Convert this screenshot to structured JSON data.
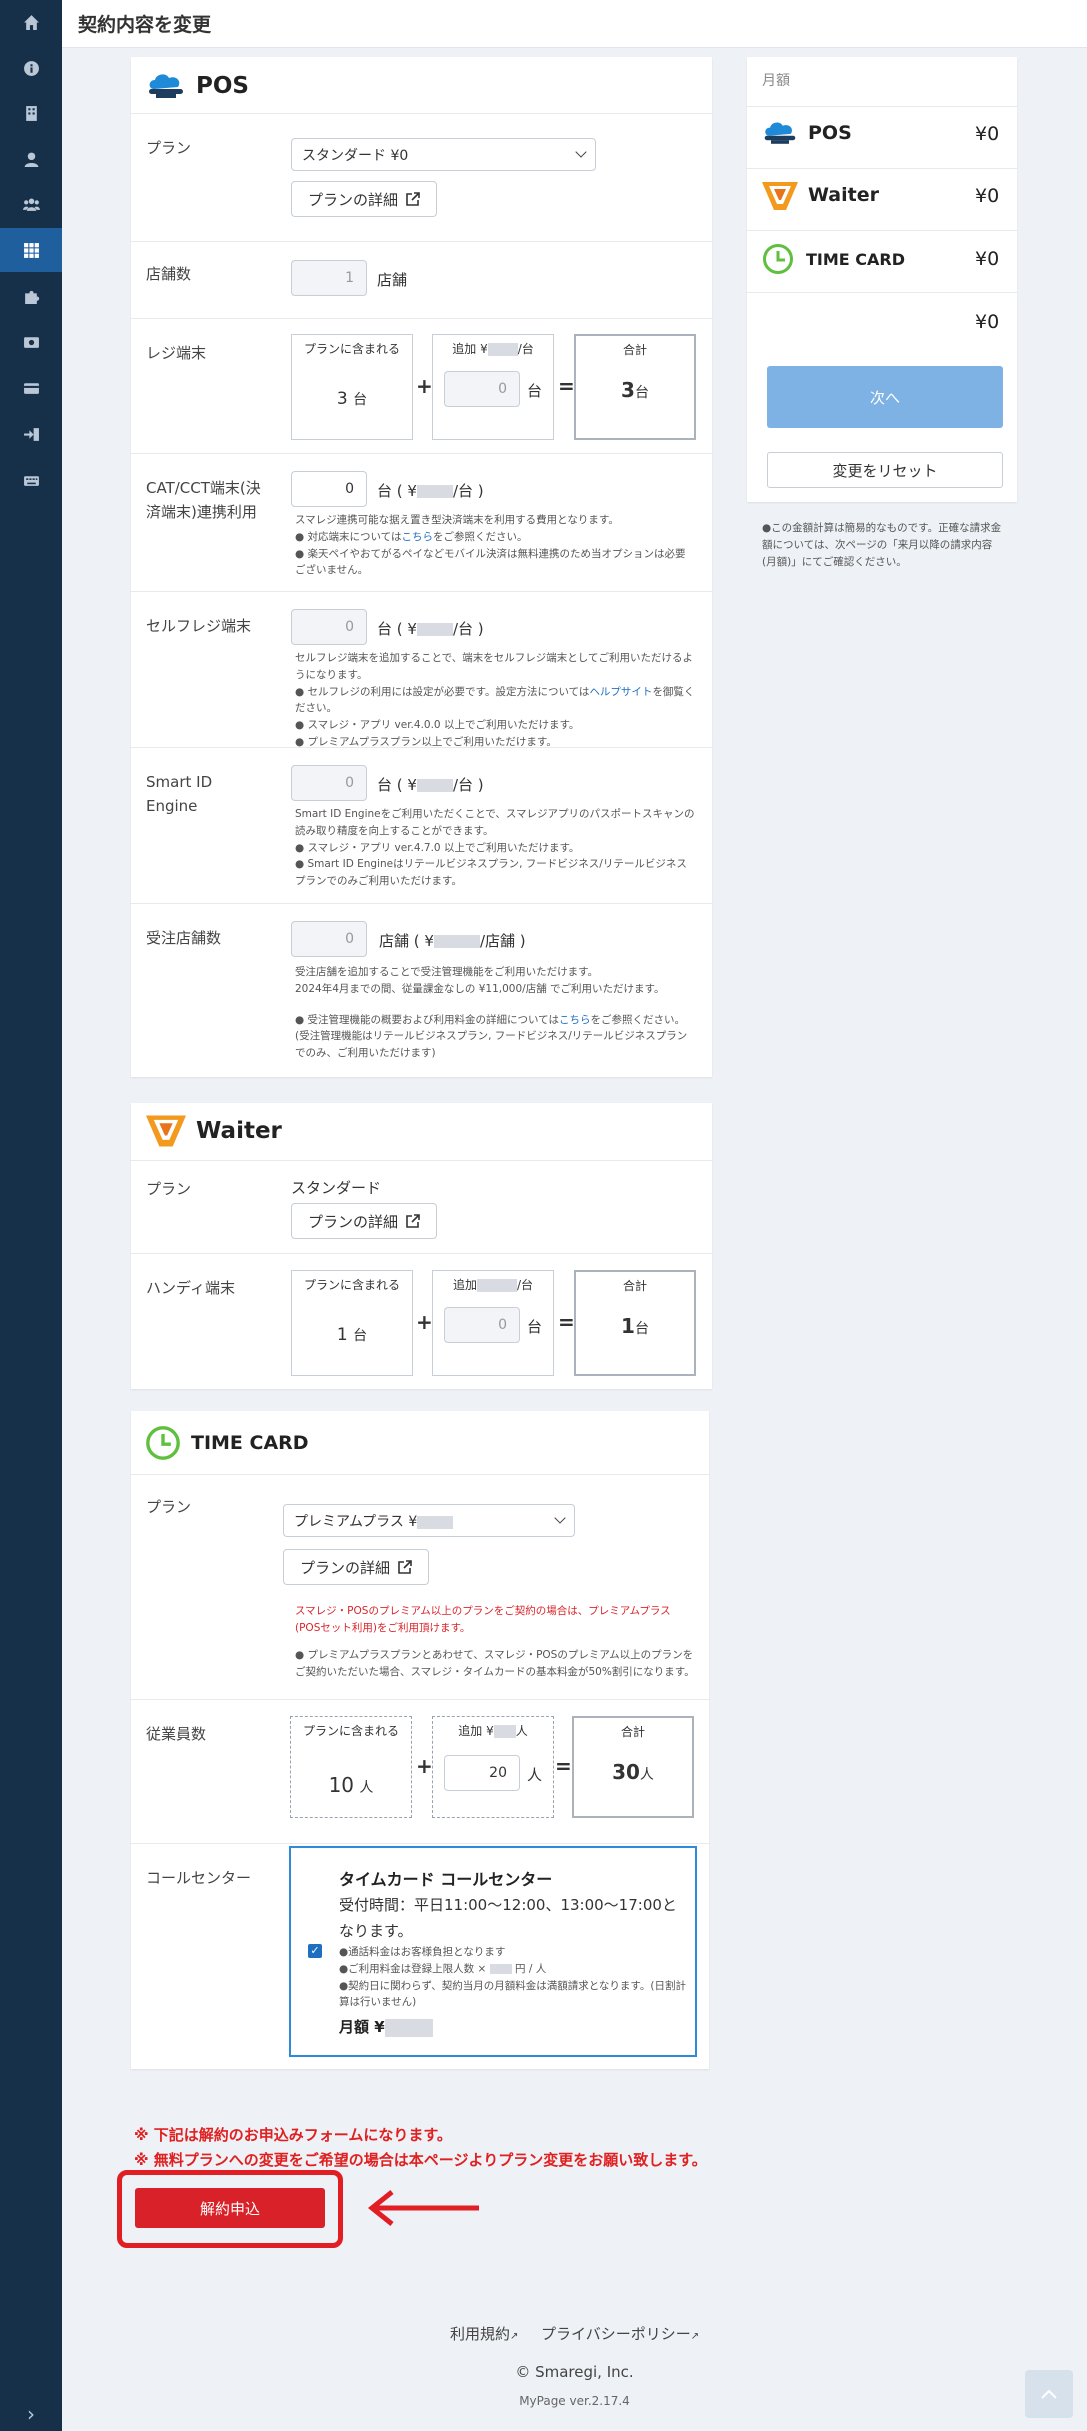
{
  "header": {
    "title": "契約内容を変更"
  },
  "pos": {
    "name": "POS",
    "plan_label": "プラン",
    "plan_value": "スタンダード ¥0",
    "plan_detail": "プランの詳細",
    "stores_label": "店舗数",
    "stores_value": "1",
    "stores_unit": "店舗",
    "register_label": "レジ端末",
    "included_label": "プランに含まれる",
    "included_value": "3",
    "unit_dai": "台",
    "additional_label": "追加 ¥",
    "per_dai": "/台",
    "additional_value": "0",
    "total_label": "合計",
    "register_total": "3",
    "cat_label": "CAT/CCT端末(決済端末)連携利用",
    "cat_value": "0",
    "unit_paren": "台 ( ¥",
    "unit_paren_end": "/台 )",
    "cat_note1": "スマレジ連携可能な据え置き型決済端末を利用する費用となります。",
    "cat_note2_pre": "● 対応端末については",
    "link_here": "こちら",
    "cat_note2_post": "をご参照ください。",
    "cat_note3": "● 楽天ペイやおてがるペイなどモバイル決済は無料連携のため当オプションは必要ございません。",
    "self_label": "セルフレジ端末",
    "self_value": "0",
    "self_note1": "セルフレジ端末を追加することで、端末をセルフレジ端末としてご利用いただけるようになります。",
    "self_note2_pre": "● セルフレジの利用には設定が必要です。設定方法については",
    "self_note2_link": "ヘルプサイト",
    "self_note2_post": "を御覧ください。",
    "self_note3": "● スマレジ・アプリ ver.4.0.0 以上でご利用いただけます。",
    "self_note4": "● プレミアムプラスプラン以上でご利用いただけます。",
    "sid_label": "Smart ID Engine",
    "sid_value": "0",
    "sid_note1": "Smart ID Engineをご利用いただくことで、スマレジアプリのパスポートスキャンの読み取り精度を向上することができます。",
    "sid_note2": "● スマレジ・アプリ ver.4.7.0 以上でご利用いただけます。",
    "sid_note3": "● Smart ID Engineはリテールビジネスプラン, フードビジネス/リテールビジネスプランでのみご利用いただけます。",
    "order_label": "受注店舗数",
    "order_value": "0",
    "order_unit_pre": "店舗 ( ¥",
    "order_unit_post": "/店舗 )",
    "order_note1": "受注店舗を追加することで受注管理機能をご利用いただけます。",
    "order_note2": "2024年4月までの間、従量課金なしの ¥11,000/店舗 でご利用いただけます。",
    "order_note3_pre": "● 受注管理機能の概要および利用料金の詳細については",
    "order_note3_post": "をご参照ください。",
    "order_note4": "(受注管理機能はリテールビジネスプラン, フードビジネス/リテールビジネスプランでのみ、ご利用いただけます)"
  },
  "waiter": {
    "name": "Waiter",
    "plan_label": "プラン",
    "plan_value": "スタンダード",
    "plan_detail": "プランの詳細",
    "handy_label": "ハンディ端末",
    "included_label": "プランに含まれる",
    "included_value": "1",
    "unit_dai": "台",
    "additional_label": "追加",
    "per_dai": "/台",
    "additional_value": "0",
    "total_label": "合計",
    "total_value": "1"
  },
  "timecard": {
    "name": "TIME CARD",
    "plan_label": "プラン",
    "plan_value": "プレミアムプラス ¥",
    "plan_detail": "プランの詳細",
    "red_note": "スマレジ・POSのプレミアム以上のプランをご契約の場合は、プレミアムプラス(POSセット利用)をご利用頂けます。",
    "note": "● プレミアムプラスプランとあわせて、スマレジ・POSのプレミアム以上のプランをご契約いただいた場合、スマレジ・タイムカードの基本料金が50%割引になります。",
    "staff_label": "従業員数",
    "included_label": "プランに含まれる",
    "included_value": "10",
    "unit_nin": "人",
    "additional_label": "追加 ¥",
    "additional_value": "20",
    "total_label": "合計",
    "total_value": "30",
    "callcenter_label": "コールセンター",
    "cc_title": "タイムカード コールセンター",
    "cc_hours": "受付時間：平日11:00〜12:00、13:00〜17:00となります。",
    "cc_note1": "●通話料金はお客様負担となります",
    "cc_note2": "●ご利用料金は登録上限人数 ×",
    "cc_note2b": "円 / 人",
    "cc_note3": "●契約日に関わらず、契約当月の月額料金は満額請求となります。(日割計算は行いません)",
    "cc_fee": "月額 ¥",
    "check": "✓"
  },
  "summary": {
    "monthly_label": "月額",
    "items": [
      {
        "name": "POS",
        "price": "¥0"
      },
      {
        "name": "Waiter",
        "price": "¥0"
      },
      {
        "name": "TIME CARD",
        "price": "¥0"
      }
    ],
    "total": "¥0",
    "next": "次へ",
    "reset": "変更をリセット",
    "note": "●この金額計算は簡易的なものです。正確な請求金額については、次ページの「来月以降の請求内容(月額)」にてご確認ください。"
  },
  "warnings": {
    "line1": "※ 下記は解約のお申込みフォームになります。",
    "line2": "※ 無料プランへの変更をご希望の場合は本ページよりプラン変更をお願い致します。"
  },
  "cancel_button": "解約申込",
  "footer": {
    "terms": "利用規約",
    "privacy": "プライバシーポリシー",
    "copyright": "© Smaregi, Inc.",
    "version": "MyPage ver.2.17.4"
  },
  "colors": {
    "primary": "#1f5f9e",
    "danger": "#d82129",
    "sidebar": "#17304a"
  }
}
